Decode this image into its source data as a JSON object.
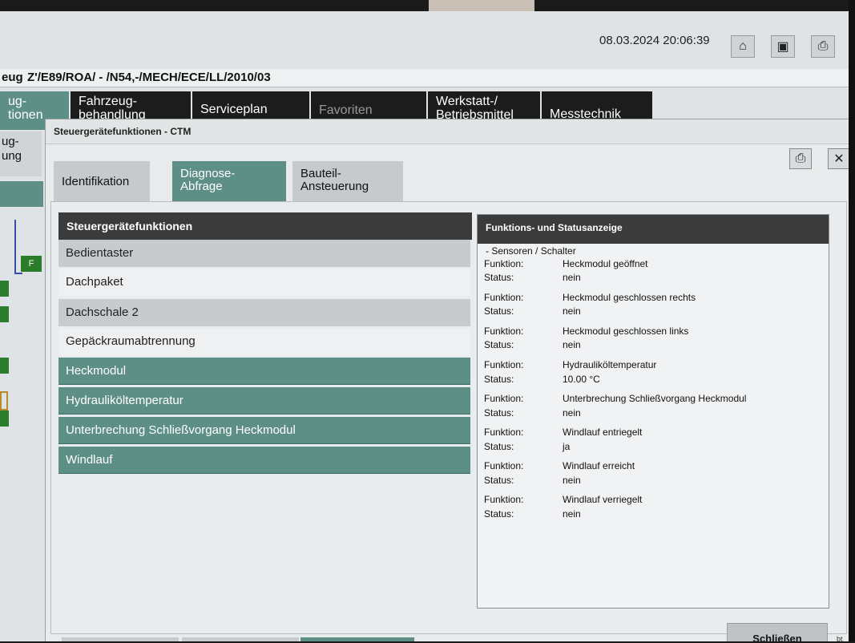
{
  "header": {
    "datetime": "08.03.2024 20:06:39",
    "vehicle_prefix": "eug",
    "vehicle_id": "Z'/E89/ROA/ - /N54,-/MECH/ECE/LL/2010/03",
    "icons": [
      "home-icon",
      "device-icon",
      "print-icon"
    ]
  },
  "main_nav": {
    "tabs": [
      {
        "label": "ug-\ntionen"
      },
      {
        "label": "Fahrzeug-\nbehandlung"
      },
      {
        "label": "Serviceplan"
      },
      {
        "label": "Favoriten"
      },
      {
        "label": "Werkstatt-/\nBetriebsmittel"
      },
      {
        "label": "Messtechnik"
      }
    ],
    "side_tab": "ug-\nung",
    "mini_label": "F"
  },
  "dialog": {
    "title": "Steuergerätefunktionen - CTM",
    "tabs": [
      {
        "label": "Identifikation"
      },
      {
        "label": "Diagnose-\nAbfrage"
      },
      {
        "label": "Bauteil-\nAnsteuerung"
      }
    ],
    "list": {
      "header": "Steuergerätefunktionen",
      "items": [
        {
          "label": "Bedientaster"
        },
        {
          "label": "Dachpaket"
        },
        {
          "label": "Dachschale 2"
        },
        {
          "label": "Gepäckraumabtrennung"
        },
        {
          "label": "Heckmodul"
        },
        {
          "label": "Hydrauliköltemperatur"
        },
        {
          "label": "Unterbrechung Schließvorgang Heckmodul"
        },
        {
          "label": "Windlauf"
        }
      ]
    },
    "status_panel": {
      "header": "Funktions- und Statusanzeige",
      "section": "- Sensoren / Schalter",
      "function_key": "Funktion:",
      "status_key": "Status:",
      "entries": [
        {
          "function": "Heckmodul geöffnet",
          "status": "nein"
        },
        {
          "function": "Heckmodul geschlossen rechts",
          "status": "nein"
        },
        {
          "function": "Heckmodul geschlossen links",
          "status": "nein"
        },
        {
          "function": "Hydrauliköltemperatur",
          "status": "10.00 °C"
        },
        {
          "function": "Unterbrechung Schließvorgang Heckmodul",
          "status": "nein"
        },
        {
          "function": "Windlauf entriegelt",
          "status": "ja"
        },
        {
          "function": "Windlauf erreicht",
          "status": "nein"
        },
        {
          "function": "Windlauf verriegelt",
          "status": "nein"
        }
      ]
    },
    "close_label": "Schließen",
    "corner_text": "bt"
  }
}
